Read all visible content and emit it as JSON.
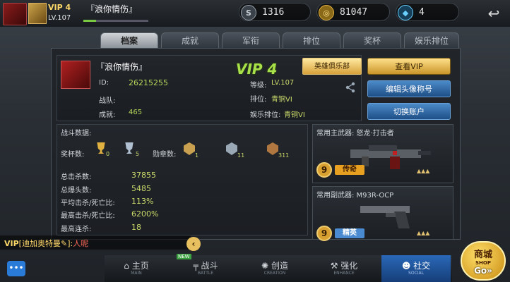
{
  "topbar": {
    "vip_label": "VIP 4",
    "level_label": "LV.107",
    "nickname": "『浪你情伤』",
    "exp_fraction": 0.2,
    "currencies": [
      {
        "icon": "silver-coin-icon",
        "glyph": "S",
        "value": "1316",
        "color": "#9aa3ad"
      },
      {
        "icon": "gold-coin-icon",
        "glyph": "◎",
        "value": "81047",
        "color": "#e6b340"
      },
      {
        "icon": "diamond-icon",
        "glyph": "◆",
        "value": "4",
        "color": "#6ad0ff"
      }
    ],
    "back_glyph": "↩"
  },
  "tabs": [
    {
      "label": "档案",
      "active": true
    },
    {
      "label": "成就",
      "active": false
    },
    {
      "label": "军衔",
      "active": false
    },
    {
      "label": "排位",
      "active": false
    },
    {
      "label": "奖杯",
      "active": false
    },
    {
      "label": "娱乐排位",
      "active": false
    }
  ],
  "profile": {
    "name": "『浪你情伤』",
    "vip_big": "VIP 4",
    "id_label": "ID:",
    "id_value": "26215255",
    "team_label": "战队:",
    "achieve_label": "成就:",
    "achieve_value": "465",
    "level_label": "等级:",
    "level_value": "LV.107",
    "rank_label": "排位:",
    "rank_value": "青铜VI",
    "fun_rank_label": "娱乐排位:",
    "fun_rank_value": "青铜VI",
    "club_button": "英雄俱乐部",
    "share_icon": "share-icon"
  },
  "actions": {
    "view_vip": "查看VIP",
    "edit_avatar": "编辑头像称号",
    "switch_account": "切换账户"
  },
  "stats": {
    "title": "战斗数据:",
    "trophy_label": "奖杯数:",
    "trophies": [
      {
        "icon": "gold-trophy-icon",
        "value": "0",
        "color": "#e0b040"
      },
      {
        "icon": "silver-trophy-icon",
        "value": "5",
        "color": "#b0c0d0"
      }
    ],
    "medal_label": "勋章数:",
    "medals": [
      {
        "icon": "gold-medal-icon",
        "value": "1",
        "color": "#c9a050"
      },
      {
        "icon": "silver-medal-icon",
        "value": "11",
        "color": "#9aa8b6"
      },
      {
        "icon": "bronze-medal-icon",
        "value": "311",
        "color": "#b07840"
      }
    ],
    "rows": [
      {
        "label": "总击杀数:",
        "value": "37855"
      },
      {
        "label": "总爆头数:",
        "value": "5485"
      },
      {
        "label": "平均击杀/死亡比:",
        "value": "113%"
      },
      {
        "label": "最高击杀/死亡比:",
        "value": "6200%"
      },
      {
        "label": "最高连杀:",
        "value": "18"
      }
    ]
  },
  "weapons": {
    "primary": {
      "title": "常用主武器: 怒龙·打击者",
      "level": "9",
      "tag": "传奇",
      "tag_color": "#e8a020",
      "stars": "▲▲▲"
    },
    "secondary": {
      "title": "常用副武器: M93R-OCP",
      "level": "9",
      "tag": "精英",
      "tag_color": "#4a8ad0",
      "stars": "▲▲▲"
    }
  },
  "chat": {
    "prefix": "VIP",
    "sender": "[迪加奥特曼",
    "icon": "pen-icon",
    "separator": "]:",
    "message": "人呢"
  },
  "nav": [
    {
      "label": "主页",
      "sub": "MAIN",
      "icon": "home-icon",
      "glyph": "⌂",
      "badge": ""
    },
    {
      "label": "战斗",
      "sub": "BATTLE",
      "icon": "gun-icon",
      "glyph": "╤",
      "badge": "NEW"
    },
    {
      "label": "创造",
      "sub": "CREATION",
      "icon": "bulb-icon",
      "glyph": "✺",
      "badge": ""
    },
    {
      "label": "强化",
      "sub": "ENHANCE",
      "icon": "hammer-icon",
      "glyph": "⚒",
      "badge": ""
    },
    {
      "label": "社交",
      "sub": "SOCIAL",
      "icon": "people-icon",
      "glyph": "👥",
      "badge": "",
      "active": true
    }
  ],
  "shop": {
    "label": "商城",
    "sub": "SHOP",
    "go": "Go»"
  },
  "colors": {
    "accent_green": "#a8e04a",
    "gold": "#e6b340",
    "blue_button": "#2a64a8"
  }
}
